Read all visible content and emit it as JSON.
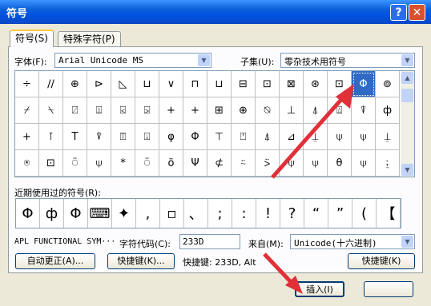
{
  "window": {
    "title": "符号"
  },
  "tabs": [
    {
      "label": "符号(S)"
    },
    {
      "label": "特殊字符(P)"
    }
  ],
  "font": {
    "label": "字体(F):",
    "value": "Arial Unicode MS"
  },
  "subset": {
    "label": "子集(U):",
    "value": "零杂技术用符号"
  },
  "symbols": [
    "÷",
    "∕∕",
    "⊕",
    "⊳",
    "◺",
    "⊔",
    "∨",
    "⊓",
    "⊔",
    "⊟",
    "⊡",
    "⊠",
    "⊛",
    "⊡",
    "Φ",
    "⊚",
    "⌿",
    "⍀",
    "⍁",
    "⍍",
    "⍃",
    "⍄",
    "+",
    "+",
    "⊞",
    "⊕",
    "⍉",
    "⊥",
    "⍋",
    "⍍",
    "⍒",
    "ф",
    "+",
    "⊺",
    "T",
    "⍒",
    "⍔",
    "⍗",
    "φ",
    "Φ",
    "⊤",
    "⍞",
    "⍋",
    "⊿",
    "⍊",
    "⍦",
    "⍦",
    "⍊",
    "⍟",
    "⊡",
    "⍥",
    "⍦",
    "*",
    "⍥",
    "ö",
    "Ψ",
    "⊄",
    "⍨",
    "⍩",
    "⍦",
    "⍦",
    "θ",
    "⍦",
    "⍮"
  ],
  "selected_index": 14,
  "recent": {
    "label": "近期使用过的符号(R):",
    "items": [
      "Φ",
      "ф",
      "Φ",
      "⌨",
      "✦",
      ",",
      "▫",
      "、",
      ";",
      ":",
      "!",
      "?",
      "“",
      "”",
      "(",
      "【"
    ]
  },
  "char_name": "APL FUNCTIONAL SYM···",
  "char_code": {
    "label": "字符代码(C):",
    "value": "233D"
  },
  "from": {
    "label": "来自(M):",
    "value": "Unicode(十六进制)"
  },
  "buttons": {
    "autocorrect": "自动更正(A)...",
    "shortcut_key": "快捷键(K)...",
    "shortcut_key2": "快捷键(K)",
    "insert": "插入(I)"
  },
  "shortcut_text": "快捷键: 233D, Alt"
}
